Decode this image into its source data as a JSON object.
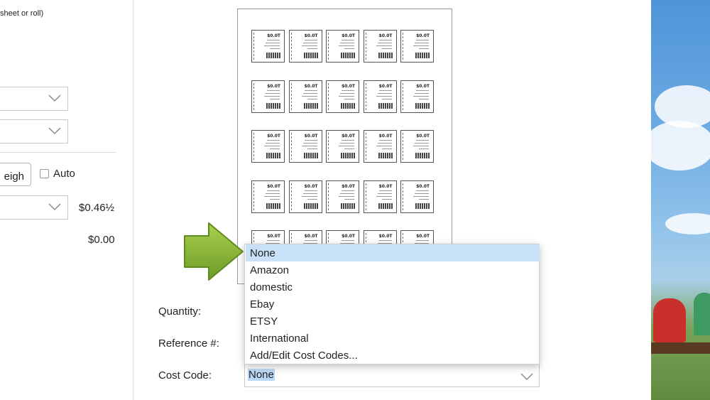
{
  "left_panel": {
    "hint_text": "sheet or roll)",
    "weigh_button_label": "eigh",
    "auto_label": "Auto",
    "price_primary": "$0.46½",
    "price_secondary": "$0.00"
  },
  "form": {
    "quantity_label": "Quantity:",
    "reference_label": "Reference #:",
    "cost_code_label": "Cost Code:",
    "cost_code_value": "None"
  },
  "cost_code_dropdown": {
    "options": [
      "None",
      "Amazon",
      "domestic",
      "Ebay",
      "ETSY",
      "International",
      "Add/Edit Cost Codes..."
    ],
    "selected_index": 0
  },
  "sheet_preview": {
    "rows": 5,
    "columns": 5,
    "label_price": "$0.0T"
  },
  "colors": {
    "highlight": "#c9e1f6",
    "selection_text_bg": "#bcd8f7",
    "arrow_green": "#8ab83a"
  },
  "icons": {
    "pointer_arrow": "green-arrow-icon",
    "dropdown_chevron": "chevron-down-icon"
  }
}
